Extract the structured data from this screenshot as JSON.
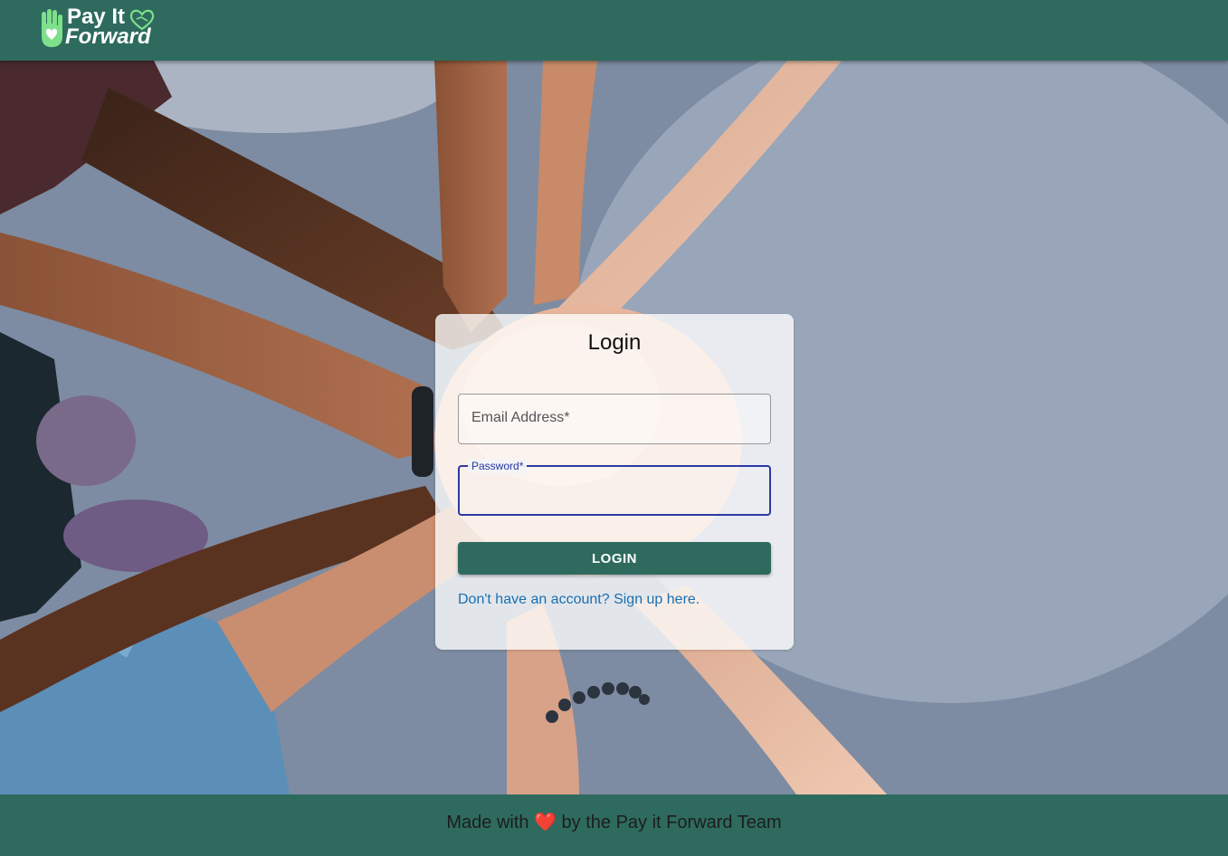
{
  "header": {
    "logo_line1": "Pay It",
    "logo_line2": "Forward"
  },
  "login": {
    "title": "Login",
    "email_label": "Email Address",
    "password_label": "Password",
    "required_mark": "*",
    "button_label": "LOGIN",
    "signup_link": "Don't have an account? Sign up here."
  },
  "footer": {
    "text_before": "Made with",
    "heart": "❤️",
    "text_after": "by the Pay it Forward Team"
  },
  "colors": {
    "brand": "#2e6b5e",
    "focus": "#2a3aa3",
    "link": "#1a6fb0"
  }
}
